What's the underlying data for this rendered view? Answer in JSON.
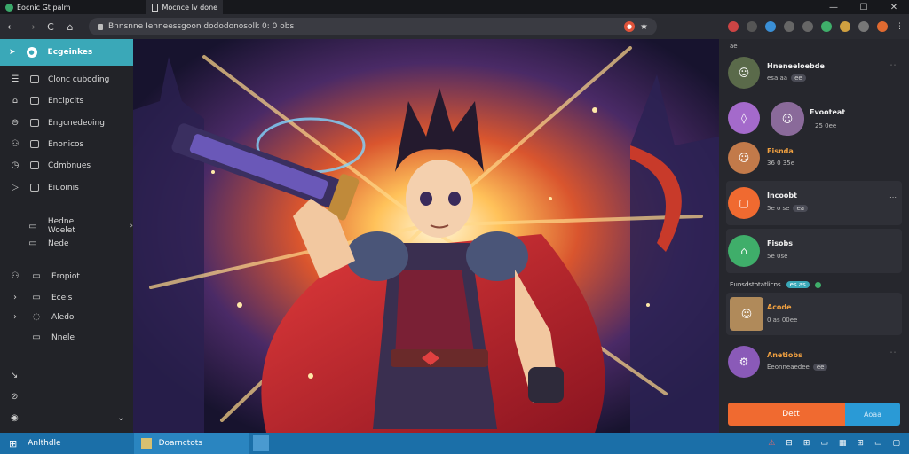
{
  "titlebar": {
    "tabs": [
      {
        "label": "Eocnic Gt palm",
        "icon": "globe-icon",
        "active": false
      },
      {
        "label": "Mocnce lv done",
        "icon": "page-icon",
        "active": true
      }
    ],
    "controls": {
      "minimize": "—",
      "maximize": "☐",
      "close": "✕"
    }
  },
  "navbar": {
    "back": "←",
    "forward": "→",
    "reload": "C",
    "home": "⌂",
    "url": "Bnnsnne Ienneessgoon dododonosolk  0: 0 obs",
    "star": "★"
  },
  "sidebar": {
    "active_label": "Ecgeinkes",
    "items": [
      {
        "label": "Clonc cuboding",
        "icon": "menu-icon"
      },
      {
        "label": "Encipcits",
        "icon": "home-icon"
      },
      {
        "label": "Engcnedeoing",
        "icon": "lock-icon"
      },
      {
        "label": "Enonicos",
        "icon": "users-icon"
      },
      {
        "label": "Cdmbnues",
        "icon": "clock-icon"
      },
      {
        "label": "Eiuoinis",
        "icon": "play-icon"
      },
      {
        "label": "Hedne Woelet",
        "icon": "folder-icon"
      },
      {
        "label": "Nede",
        "icon": "box-icon"
      },
      {
        "label": "Eropiot",
        "icon": "users-icon"
      },
      {
        "label": "Eceis",
        "icon": "chevron-right-icon"
      },
      {
        "label": "Aledo",
        "icon": "settings-icon"
      },
      {
        "label": "Nnele",
        "icon": "box-icon"
      }
    ]
  },
  "rpanel": {
    "header": "ae",
    "section_label": "Eunsdstotatlicns",
    "section_badge": "es as",
    "cards": [
      {
        "name": "Hneneeloebde",
        "meta": "esa aa",
        "pill": "ee"
      },
      {
        "name": "Evooteat",
        "meta": "25  0ee"
      },
      {
        "name": "Fisnda",
        "meta": "36  0 35e"
      },
      {
        "name": "Incoobt",
        "meta": "5e  o se",
        "pill": "ea"
      },
      {
        "name": "Fisobs",
        "meta": "5e  0se"
      },
      {
        "name": "Acode",
        "meta": "0 as  00ee"
      },
      {
        "name": "Anetiobs",
        "meta": "Eeonneaedee",
        "pill": "ee"
      }
    ],
    "primary_button": "Dett",
    "secondary_button": "Aoaa"
  },
  "taskbar": {
    "start": "Anlthdle",
    "window": "Doarnctots"
  },
  "colors": {
    "accent": "#3aa8b8",
    "taskbar": "#1b6fa8",
    "orange": "#f06a30",
    "purple": "#a46acb",
    "green": "#3fae6a"
  }
}
